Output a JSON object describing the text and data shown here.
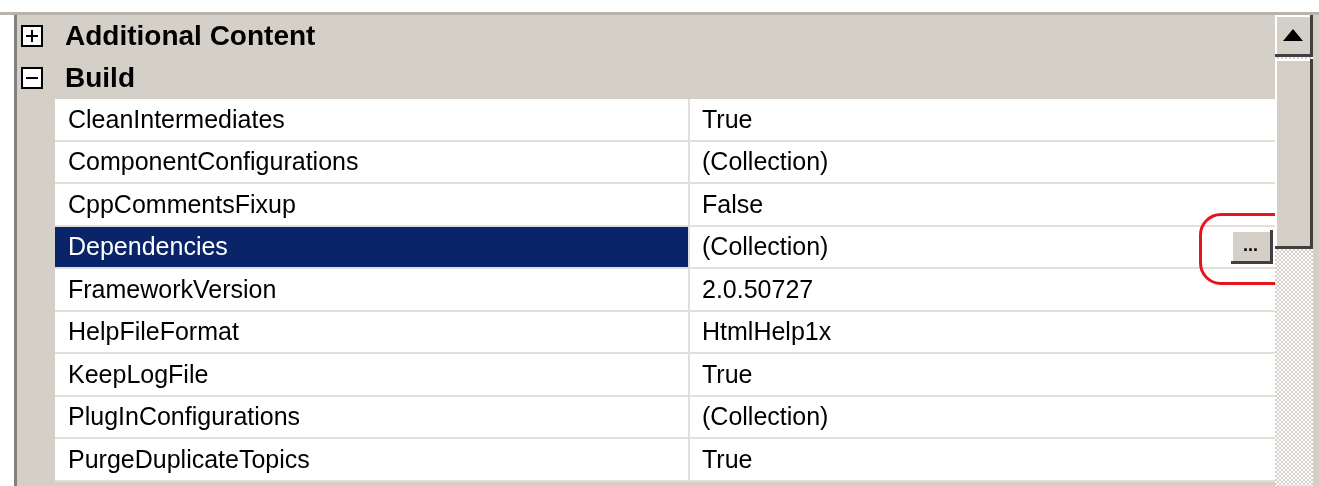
{
  "property_grid": {
    "categories": [
      {
        "name": "Additional Content",
        "expanded": false
      },
      {
        "name": "Build",
        "expanded": true,
        "properties": [
          {
            "name": "CleanIntermediates",
            "value": "True",
            "selected": false
          },
          {
            "name": "ComponentConfigurations",
            "value": "(Collection)",
            "selected": false
          },
          {
            "name": "CppCommentsFixup",
            "value": "False",
            "selected": false
          },
          {
            "name": "Dependencies",
            "value": "(Collection)",
            "selected": true,
            "button": "...",
            "annotated": true
          },
          {
            "name": "FrameworkVersion",
            "value": "2.0.50727",
            "selected": false
          },
          {
            "name": "HelpFileFormat",
            "value": "HtmlHelp1x",
            "selected": false
          },
          {
            "name": "KeepLogFile",
            "value": "True",
            "selected": false
          },
          {
            "name": "PlugInConfigurations",
            "value": "(Collection)",
            "selected": false
          },
          {
            "name": "PurgeDuplicateTopics",
            "value": "True",
            "selected": false
          }
        ]
      }
    ]
  }
}
